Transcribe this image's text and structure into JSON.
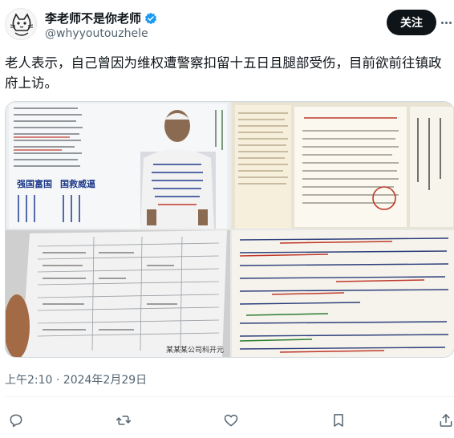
{
  "author": {
    "display_name": "李老师不是你老师",
    "handle": "@whyyoutouzhele",
    "verified": true
  },
  "follow_label": "关注",
  "tweet": {
    "text": "老人表示，自己曾因为维权遭警察扣留十五日且腿部受伤，目前欲前往镇政府上访。"
  },
  "media": {
    "photos": [
      {
        "desc_icon": "document-with-man-photo"
      },
      {
        "desc_icon": "bank-statement-document"
      },
      {
        "desc_icon": "form-document"
      },
      {
        "desc_icon": "handwritten-document"
      }
    ],
    "sign_texts": {
      "left_big_1": "强国富国",
      "left_big_2": "国救威逼",
      "bottom_stamp": "某某某公司科开元"
    }
  },
  "timestamp": "上午2:10 · 2024年2月29日",
  "colors": {
    "accent": "#1d9bf0",
    "text": "#0f1419",
    "muted": "#536471",
    "button_bg": "#0f1419"
  }
}
